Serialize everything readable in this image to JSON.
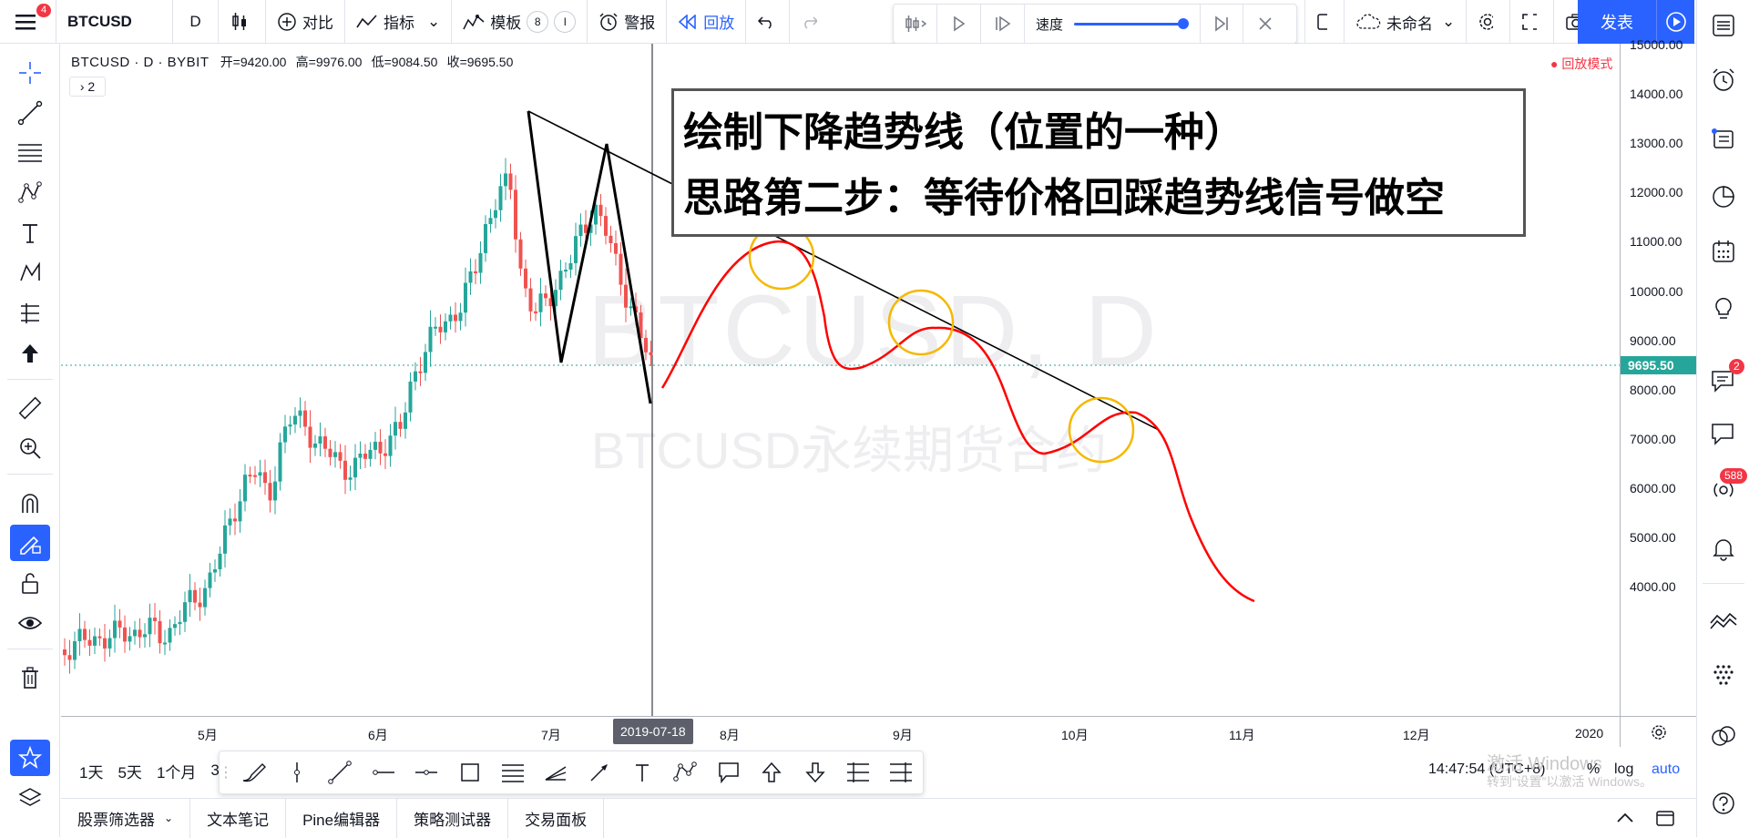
{
  "topbar": {
    "menu_badge": "4",
    "symbol": "BTCUSD",
    "timeframe": "D",
    "compare": "对比",
    "indicators": "指标",
    "templates": "模板",
    "template_badge_1": "8",
    "template_badge_2": "I",
    "alert": "警报",
    "replay": "回放",
    "speed_label": "速度",
    "layout_name": "未命名",
    "publish": "发表"
  },
  "legend": {
    "symbol": "BTCUSD · D · BYBIT",
    "open": "开=9420.00",
    "high": "高=9976.00",
    "low": "低=9084.50",
    "close": "收=9695.50",
    "collapse": "› 2"
  },
  "replay_mode": "● 回放模式",
  "watermark": {
    "line1": "BTCUSD, D",
    "line2": "BTCUSD永续期货合约"
  },
  "annotation": {
    "line1": "绘制下降趋势线（位置的一种）",
    "line2": "思路第二步：等待价格回踩趋势线信号做空"
  },
  "price_axis": {
    "labels": [
      "15000.00",
      "14000.00",
      "13000.00",
      "12000.00",
      "11000.00",
      "10000.00",
      "9000.00",
      "8000.00",
      "7000.00",
      "6000.00",
      "5000.00",
      "4000.00"
    ],
    "current_price": "9695.50"
  },
  "time_axis": {
    "labels": [
      "5月",
      "6月",
      "7月",
      "8月",
      "9月",
      "10月",
      "11月",
      "12月",
      "2020"
    ],
    "cursor_date": "2019-07-18"
  },
  "bottom_toolbar": {
    "ranges": [
      "1天",
      "5天",
      "1个月",
      "3"
    ],
    "clock": "14:47:54 (UTC+8)",
    "percent": "%",
    "log": "log",
    "auto": "auto"
  },
  "windows_watermark": {
    "line1": "激活 Windows",
    "line2": "转到“设置”以激活 Windows。"
  },
  "bottom_tabs": [
    "股票筛选器",
    "文本笔记",
    "Pine编辑器",
    "策略测试器",
    "交易面板"
  ],
  "right_badges": {
    "chat": "2",
    "streams": "588"
  },
  "colors": {
    "accent": "#2962ff",
    "up": "#26a69a",
    "down": "#ef5350",
    "badge": "#f23645",
    "drawing_red": "#ff0000",
    "circle": "#f5b800"
  }
}
